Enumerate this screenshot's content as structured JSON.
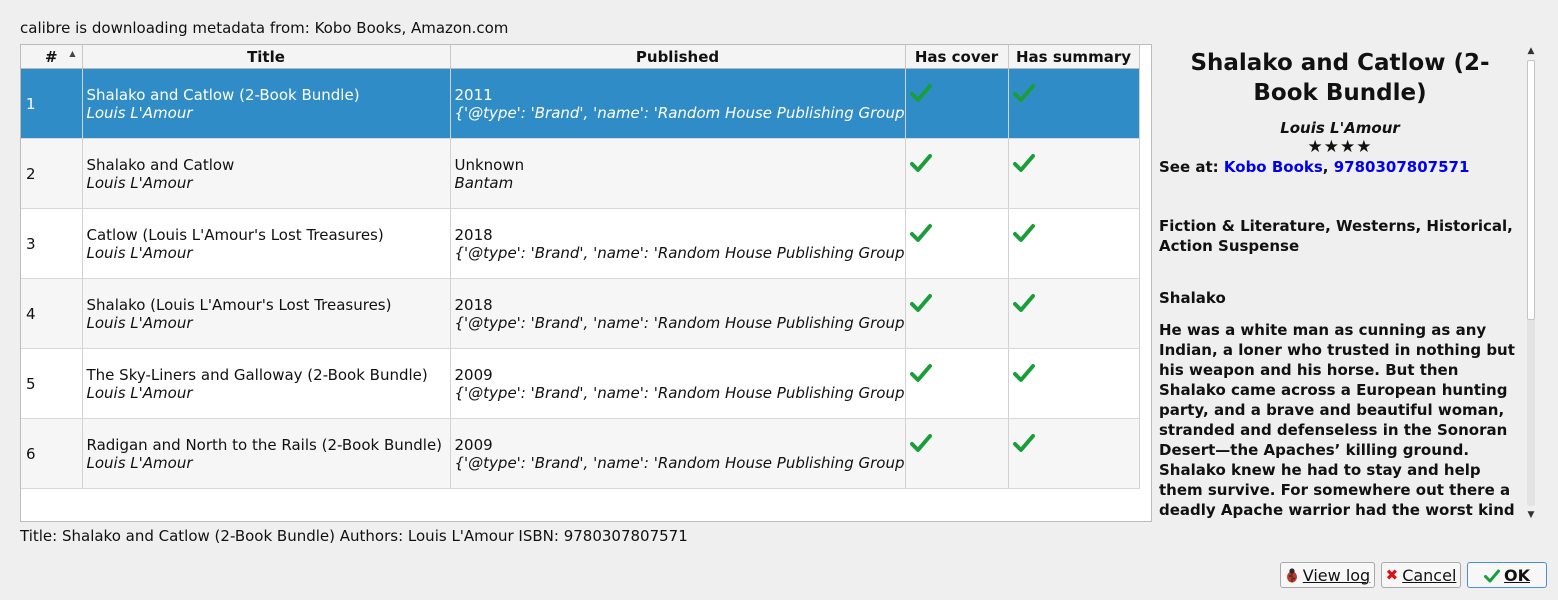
{
  "status_top": "calibre is downloading metadata from: Kobo Books, Amazon.com",
  "columns": {
    "num": "#",
    "title": "Title",
    "published": "Published",
    "has_cover": "Has cover",
    "has_summary": "Has summary"
  },
  "sort_indicator": "▲",
  "rows": [
    {
      "num": "1",
      "title": "Shalako and Catlow (2-Book Bundle)",
      "author": "Louis L'Amour",
      "published": "2011",
      "publisher": "{'@type': 'Brand', 'name': 'Random House Publishing Group'}",
      "has_cover": true,
      "has_summary": true
    },
    {
      "num": "2",
      "title": "Shalako and Catlow",
      "author": "Louis L'Amour",
      "published": "Unknown",
      "publisher": "Bantam",
      "has_cover": true,
      "has_summary": true
    },
    {
      "num": "3",
      "title": "Catlow (Louis L'Amour's Lost Treasures)",
      "author": "Louis L'Amour",
      "published": "2018",
      "publisher": "{'@type': 'Brand', 'name': 'Random House Publishing Group'}",
      "has_cover": true,
      "has_summary": true
    },
    {
      "num": "4",
      "title": "Shalako (Louis L'Amour's Lost Treasures)",
      "author": "Louis L'Amour",
      "published": "2018",
      "publisher": "{'@type': 'Brand', 'name': 'Random House Publishing Group'}",
      "has_cover": true,
      "has_summary": true
    },
    {
      "num": "5",
      "title": "The Sky-Liners and Galloway (2-Book Bundle)",
      "author": "Louis L'Amour",
      "published": "2009",
      "publisher": "{'@type': 'Brand', 'name': 'Random House Publishing Group'}",
      "has_cover": true,
      "has_summary": true
    },
    {
      "num": "6",
      "title": "Radigan and North to the Rails (2-Book Bundle)",
      "author": "Louis L'Amour",
      "published": "2009",
      "publisher": "{'@type': 'Brand', 'name': 'Random House Publishing Group'}",
      "has_cover": true,
      "has_summary": true
    }
  ],
  "selected_row": "1",
  "details": {
    "title": "Shalako and Catlow (2-Book Bundle)",
    "author": "Louis L'Amour",
    "stars": "★★★★",
    "rating": 4,
    "see_at_label": "See at:",
    "link_kobo": "Kobo Books",
    "link_sep": ",",
    "link_isbn": "9780307807571",
    "tags": "Fiction & Literature, Westerns, Historical, Action Suspense",
    "subtitle": "Shalako",
    "summary": "He was a white man as cunning as any Indian, a loner who trusted in nothing but his weapon and his horse. But then Shalako came across a European hunting party, and a brave and beautiful woman, stranded and defenseless in the Sonoran Desert—the Apaches’ killing ground. Shalako knew he had to stay and help them survive. For somewhere out there a deadly Apache warrior had the worst kind of death in mind"
  },
  "status_bottom": "Title: Shalako and Catlow (2-Book Bundle) Authors: Louis L'Amour ISBN: 9780307807571",
  "buttons": {
    "view_log": "View log",
    "cancel": "Cancel",
    "ok": "OK"
  },
  "icons": {
    "check": "checkmark-icon",
    "bug": "bug-icon",
    "cancel": "x-icon",
    "ok": "ok-check-icon"
  },
  "colors": {
    "selection": "#308cc6",
    "check": "#1a9e3a",
    "link": "#0000ee",
    "cancel_icon": "#dd1111"
  }
}
